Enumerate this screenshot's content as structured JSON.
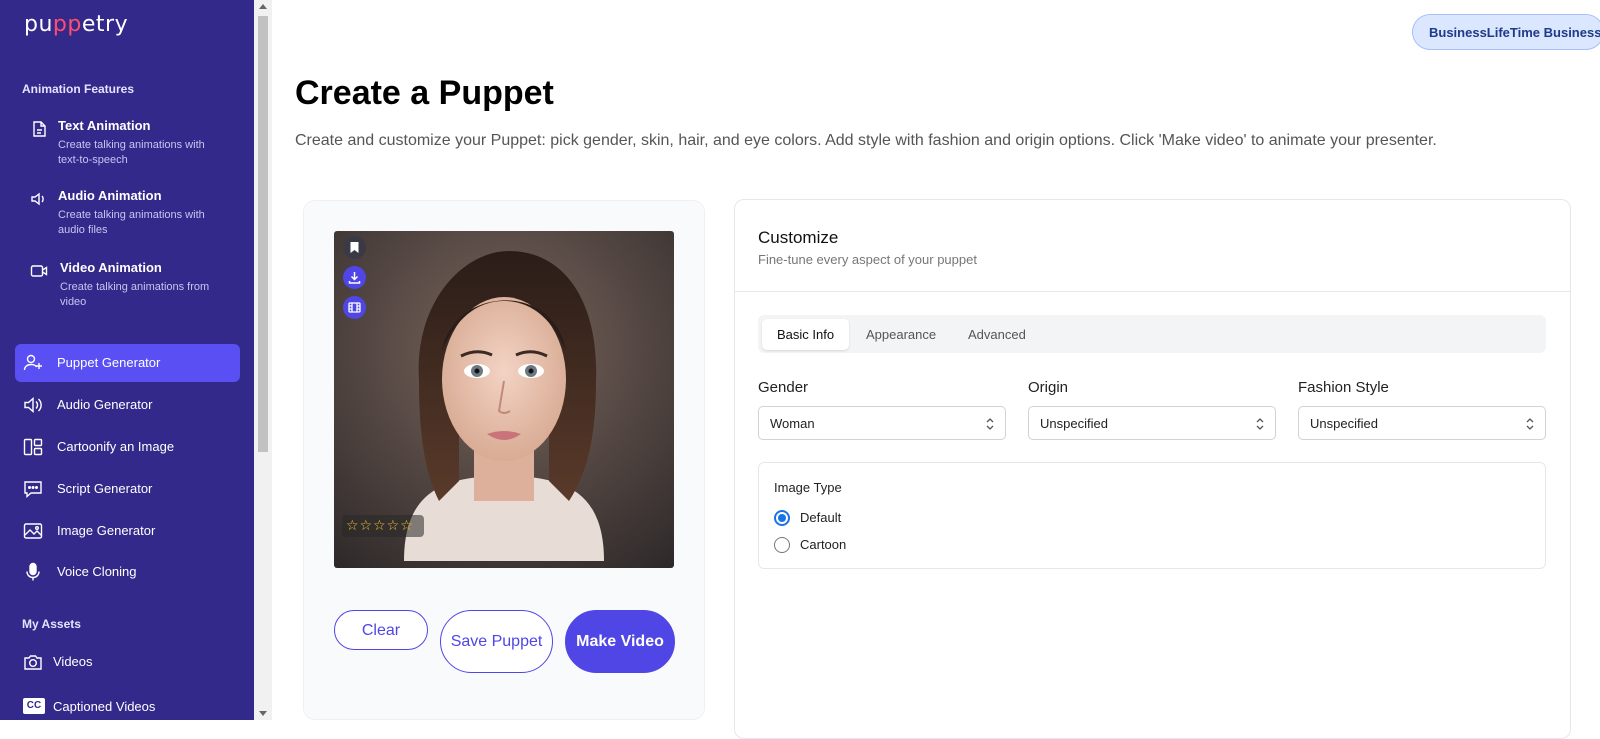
{
  "app": {
    "logo_text_a": "pu",
    "logo_text_b": "pp",
    "logo_text_c": "etry"
  },
  "sidebar": {
    "features_title": "Animation Features",
    "features": [
      {
        "title": "Text Animation",
        "desc": "Create talking animations with text-to-speech",
        "icon": "document-icon"
      },
      {
        "title": "Audio Animation",
        "desc": "Create talking animations with audio files",
        "icon": "speaker-icon"
      },
      {
        "title": "Video Animation",
        "desc": "Create talking animations from video",
        "icon": "video-camera-icon"
      }
    ],
    "nav": [
      {
        "label": "Puppet Generator",
        "icon": "user-plus-icon",
        "active": true
      },
      {
        "label": "Audio Generator",
        "icon": "speaker-icon"
      },
      {
        "label": "Cartoonify an Image",
        "icon": "layout-icon"
      },
      {
        "label": "Script Generator",
        "icon": "chat-icon"
      },
      {
        "label": "Image Generator",
        "icon": "image-icon"
      },
      {
        "label": "Voice Cloning",
        "icon": "microphone-icon"
      }
    ],
    "assets_title": "My Assets",
    "assets": [
      {
        "label": "Videos",
        "icon": "camera-icon"
      },
      {
        "label": "Captioned Videos",
        "icon": "cc-icon",
        "icon_text": "CC"
      }
    ],
    "colors": {
      "background": "#33298a",
      "active": "#5a4ff2"
    }
  },
  "header": {
    "plan_badge": "BusinessLifeTime Business"
  },
  "main": {
    "title": "Create a Puppet",
    "subtitle": "Create and customize your Puppet: pick gender, skin, hair, and eye colors. Add style with fashion and origin options. Click 'Make video' to animate your presenter."
  },
  "preview": {
    "rating_stars": "☆☆☆☆☆",
    "actions": {
      "clear": "Clear",
      "save": "Save Puppet",
      "make_video": "Make Video"
    }
  },
  "customize": {
    "title": "Customize",
    "subtitle": "Fine-tune every aspect of your puppet",
    "tabs": [
      "Basic Info",
      "Appearance",
      "Advanced"
    ],
    "active_tab": "Basic Info",
    "fields": {
      "gender": {
        "label": "Gender",
        "value": "Woman"
      },
      "origin": {
        "label": "Origin",
        "value": "Unspecified"
      },
      "fashion": {
        "label": "Fashion Style",
        "value": "Unspecified"
      }
    },
    "image_type": {
      "label": "Image Type",
      "options": [
        "Default",
        "Cartoon"
      ],
      "selected": "Default"
    }
  },
  "colors": {
    "accent": "#4f46e5",
    "radio": "#1a73e8"
  }
}
